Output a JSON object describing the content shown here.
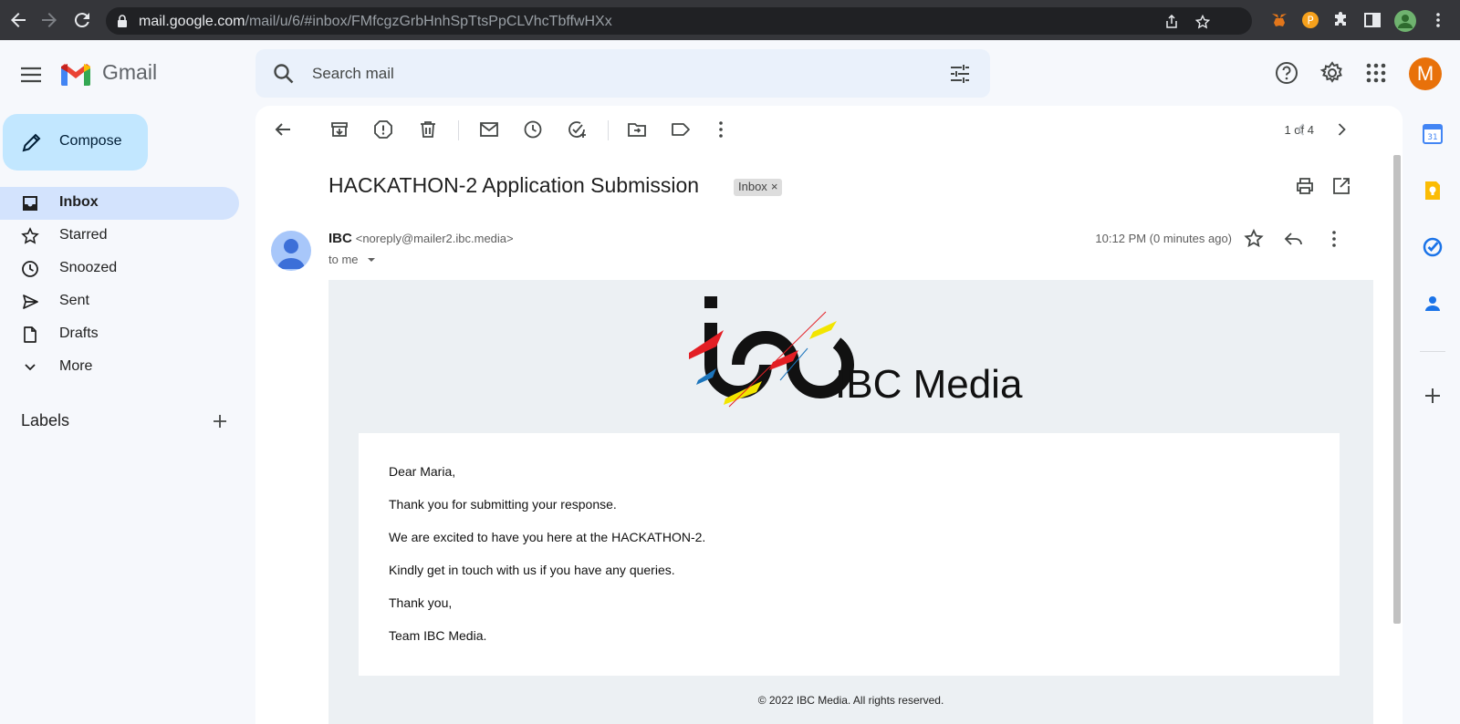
{
  "browser": {
    "url_host": "mail.google.com",
    "url_path": "/mail/u/6/#inbox/FMfcgzGrbHnhSpTtsPpCLVhcTbffwHXx"
  },
  "app": {
    "name": "Gmail",
    "avatar_letter": "M",
    "avatar_color": "#e8710a"
  },
  "search": {
    "placeholder": "Search mail"
  },
  "sidebar": {
    "compose_label": "Compose",
    "items": [
      {
        "label": "Inbox",
        "icon": "inbox-icon",
        "active": true
      },
      {
        "label": "Starred",
        "icon": "star-icon"
      },
      {
        "label": "Snoozed",
        "icon": "clock-icon"
      },
      {
        "label": "Sent",
        "icon": "send-icon"
      },
      {
        "label": "Drafts",
        "icon": "file-icon"
      },
      {
        "label": "More",
        "icon": "chevron-down-icon"
      }
    ],
    "labels_heading": "Labels"
  },
  "toolbar": {
    "pager": "1 of 4"
  },
  "message": {
    "subject": "HACKATHON-2 Application Submission",
    "label_chip": "Inbox",
    "sender_name": "IBC",
    "sender_email": "<noreply@mailer2.ibc.media>",
    "to": "to me",
    "time": "10:12 PM (0 minutes ago)",
    "brand_name": "IBC Media",
    "body": [
      "Dear Maria,",
      "Thank you for submitting your response.",
      "We are excited to have you here at the HACKATHON-2.",
      "Kindly get in touch with us if you have any queries.",
      "Thank you,",
      "Team IBC Media."
    ],
    "footer": "© 2022 IBC Media. All rights reserved."
  }
}
